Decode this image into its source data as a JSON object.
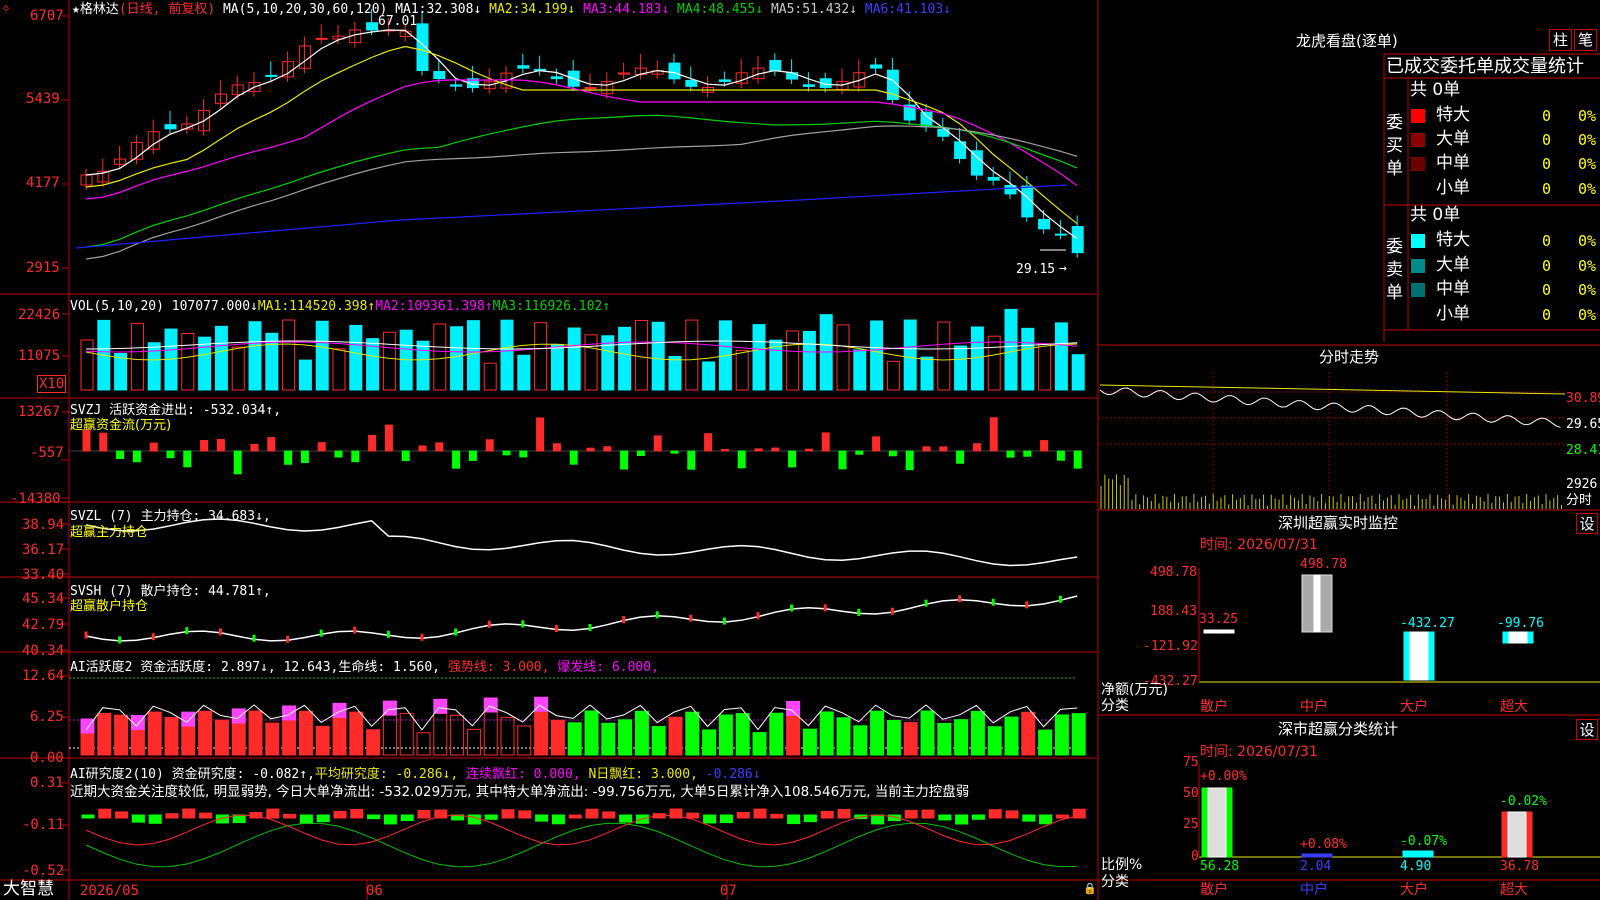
{
  "colors": {
    "up": "#ff2a2a",
    "down": "#00f0ff",
    "frame": "#c00000",
    "ma1": "#ffffff",
    "ma2": "#e8e800",
    "ma3": "#ff00ff",
    "ma4": "#00d000",
    "ma5": "#a0a0a0",
    "ma6": "#2020ff",
    "green": "#00ff00",
    "yellow": "#ffff00"
  },
  "price_panel": {
    "star": "★",
    "stock_name": "格林达",
    "period": "(日线, 前复权)",
    "ma_params": "MA(5,10,20,30,60,120)",
    "ma": [
      {
        "label": "MA1:",
        "value": "32.308↓"
      },
      {
        "label": "MA2:",
        "value": "34.199↓"
      },
      {
        "label": "MA3:",
        "value": "44.183↓"
      },
      {
        "label": "MA4:",
        "value": "48.455↓"
      },
      {
        "label": "MA5:",
        "value": "51.432↓"
      },
      {
        "label": "MA6:",
        "value": "41.103↓"
      }
    ],
    "y_ticks": [
      "6707",
      "5439",
      "4177",
      "2915"
    ],
    "high_label": "67.01",
    "low_label": "29.15"
  },
  "volume_panel": {
    "title": "VOL(5,10,20)",
    "value": "107077.000↓",
    "ma": [
      {
        "label": "MA1:",
        "value": "114520.398↑"
      },
      {
        "label": "MA2:",
        "value": "109361.398↑"
      },
      {
        "label": "MA3:",
        "value": "116926.102↑"
      }
    ],
    "y_ticks": [
      "22426",
      "11075"
    ],
    "unit": "X10"
  },
  "svzj_panel": {
    "title": "SVZJ  活跃资金进出:",
    "value": "-532.034↑,",
    "subtitle": "超赢资金流(万元)",
    "y_ticks": [
      "13267",
      "-557",
      "-14380"
    ]
  },
  "svzl_panel": {
    "title": "SVZL (7) 主力持仓:",
    "value": "34.683↓,",
    "subtitle": "超赢主力持仓",
    "y_ticks": [
      "38.94",
      "36.17",
      "33.40"
    ]
  },
  "svsh_panel": {
    "title": "SVSH (7) 散户持仓:",
    "value": "44.781↑,",
    "subtitle": "超赢散户持仓",
    "y_ticks": [
      "45.34",
      "42.79",
      "40.34"
    ]
  },
  "ai_active_panel": {
    "title": "AI活跃度2 资金活跃度:",
    "value": "2.897↓,",
    "v2": "12.643,",
    "life": "生命线: 1.560,",
    "strong": "强势线: 3.000,",
    "burst": "爆发线: 6.000,",
    "y_ticks": [
      "12.64",
      "6.25",
      "0.00"
    ]
  },
  "ai_research_panel": {
    "title": "AI研究度2(10) 资金研究度:",
    "value": "-0.082↑,",
    "avg": "平均研究度: -0.286↓,",
    "lianxu": "连续飘红: 0.000,",
    "nday": "N日飘红: 3.000,",
    "last": "-0.286↓",
    "comment": "近期大资金关注度较低, 明显弱势, 今日大单净流出: -532.029万元, 其中特大单净流出: -99.756万元, 大单5日累计净入108.546万元, 当前主力控盘弱",
    "y_ticks": [
      "0.31",
      "-0.11",
      "-0.52"
    ]
  },
  "bottom_bar": {
    "brand": "大智慧",
    "dates": [
      "2026/05",
      "06",
      "07"
    ]
  },
  "dragon_tiger": {
    "title": "龙虎看盘(逐单)",
    "btn_bar": "柱",
    "btn_pen": "笔",
    "tabs": [
      "已成交",
      "委托单",
      "成交量统计"
    ],
    "buy": {
      "side_label": "委买单",
      "total": "共 0单",
      "rows": [
        {
          "name": "特大",
          "qty": "0",
          "pct": "0%"
        },
        {
          "name": "大单",
          "qty": "0",
          "pct": "0%"
        },
        {
          "name": "中单",
          "qty": "0",
          "pct": "0%"
        },
        {
          "name": "小单",
          "qty": "0",
          "pct": "0%"
        }
      ]
    },
    "sell": {
      "side_label": "委卖单",
      "total": "共 0单",
      "rows": [
        {
          "name": "特大",
          "qty": "0",
          "pct": "0%"
        },
        {
          "name": "大单",
          "qty": "0",
          "pct": "0%"
        },
        {
          "name": "中单",
          "qty": "0",
          "pct": "0%"
        },
        {
          "name": "小单",
          "qty": "0",
          "pct": "0%"
        }
      ]
    }
  },
  "intraday": {
    "title": "分时走势",
    "prices": [
      "30.89",
      "29.65",
      "28.41"
    ],
    "volume": "2926",
    "volume_unit": "分时"
  },
  "sz_monitor": {
    "title": "深圳超赢实时监控",
    "btn": "设",
    "time": "时间: 2026/07/31",
    "y_ticks": [
      "498.78",
      "188.43",
      "-121.92",
      "-432.27"
    ],
    "y_unit": "净额(万元)",
    "x_unit": "分类",
    "categories": [
      "散户",
      "中户",
      "大户",
      "超大"
    ],
    "values": [
      33.25,
      498.78,
      -432.27,
      -99.76
    ],
    "value_labels": [
      "33.25",
      "498.78",
      "-432.27",
      "-99.76"
    ]
  },
  "sz_category": {
    "title": "深市超赢分类统计",
    "btn": "设",
    "time": "时间: 2026/07/31",
    "y_ticks": [
      "75",
      "50",
      "25",
      "0"
    ],
    "y_unit": "比例%",
    "x_unit": "分类",
    "categories": [
      "散户",
      "中户",
      "大户",
      "超大"
    ],
    "values": [
      56.28,
      2.04,
      4.9,
      36.78
    ],
    "value_labels": [
      "56.28",
      "2.04",
      "4.90",
      "36.78"
    ],
    "change_labels": [
      "+0.00%",
      "+0.08%",
      "-0.07%",
      "-0.02%"
    ]
  }
}
